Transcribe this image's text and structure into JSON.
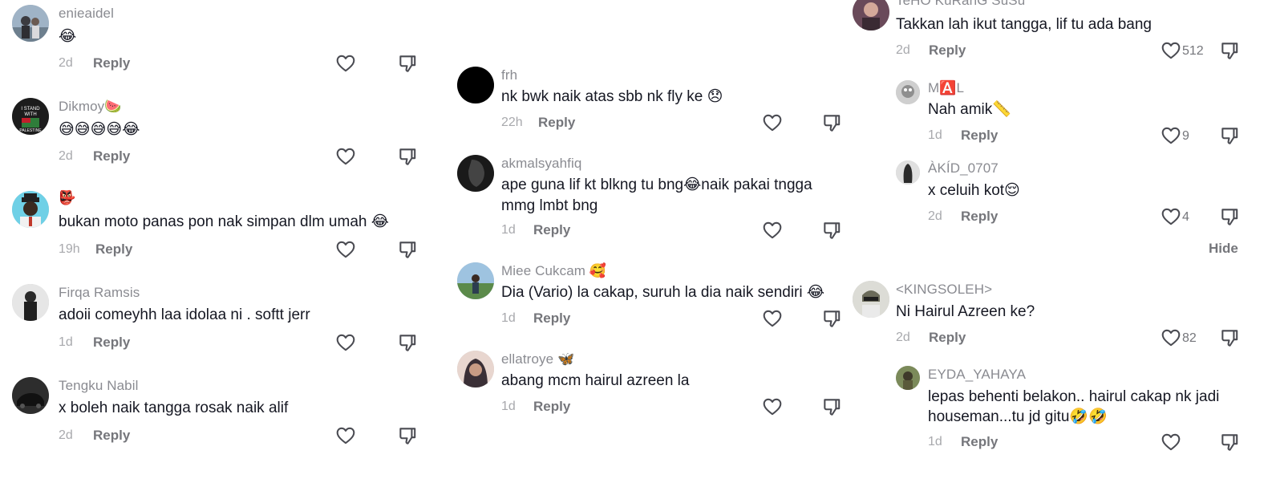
{
  "columns": [
    {
      "comments": [
        {
          "username": "enieaidel",
          "text": "😂",
          "time": "2d",
          "reply": "Reply"
        },
        {
          "username": "Dikmoy🍉",
          "text": "😅😅😅😅😂",
          "time": "2d",
          "reply": "Reply"
        },
        {
          "username": "👺",
          "text": "bukan moto panas pon nak simpan dlm umah 😂",
          "time": "19h",
          "reply": "Reply"
        },
        {
          "username": "Firqa Ramsis",
          "text": "adoii comeyhh laa idolaa ni . softt jerr",
          "time": "1d",
          "reply": "Reply"
        },
        {
          "username": "Tengku Nabil",
          "text": "x boleh naik tangga rosak naik alif",
          "time": "2d",
          "reply": "Reply"
        }
      ]
    },
    {
      "comments": [
        {
          "username": "frh",
          "text": "nk bwk naik atas sbb nk fly ke 😞",
          "time": "22h",
          "reply": "Reply"
        },
        {
          "username": "akmalsyahfiq",
          "text_line1": "ape guna lif kt blkng tu bng😂naik pakai tngga",
          "text_line2": "mmg lmbt bng",
          "time": "1d",
          "reply": "Reply"
        },
        {
          "username": "Miee Cukcam 🥰",
          "text": "Dia (Vario) la cakap, suruh la dia naik sendiri 😂",
          "time": "1d",
          "reply": "Reply"
        },
        {
          "username": "ellatroye 🦋",
          "text": "abang mcm hairul azreen la",
          "time": "1d",
          "reply": "Reply"
        }
      ]
    },
    {
      "comments": [
        {
          "username": "TeHO KuRanG SuSu",
          "text": "Takkan lah ikut tangga, lif tu ada bang",
          "time": "2d",
          "reply": "Reply",
          "likes": "512"
        },
        {
          "username": "M🅰️L",
          "text": "Nah amik📏",
          "time": "1d",
          "reply": "Reply",
          "likes": "9"
        },
        {
          "username": "ÀKÍD_0707",
          "text": "x celuih kot😌",
          "time": "2d",
          "reply": "Reply",
          "likes": "4"
        },
        {
          "username": "<KINGSOLEH>",
          "text": "Ni Hairul Azreen ke?",
          "time": "2d",
          "reply": "Reply",
          "likes": "82"
        },
        {
          "username": "EYDA_YAHAYA",
          "text_line1": "lepas behenti belakon.. hairul cakap nk jadi",
          "text_line2": "houseman...tu jd gitu🤣🤣",
          "time": "1d",
          "reply": "Reply"
        }
      ],
      "hide_label": "Hide"
    }
  ],
  "colors": {
    "text": "#161823",
    "muted": "#8a8b91",
    "meta": "#a8a9ad",
    "background": "#ffffff"
  },
  "icons": [
    "heart-icon",
    "thumbs-down-icon"
  ]
}
